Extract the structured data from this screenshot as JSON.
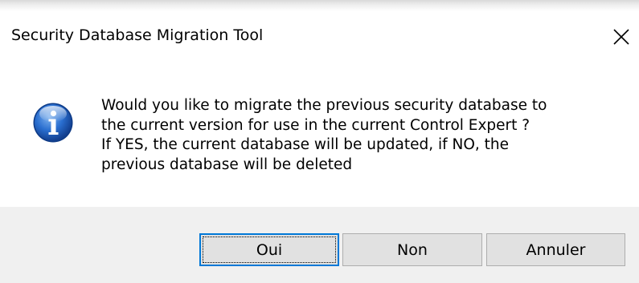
{
  "window": {
    "title": "Security Database Migration Tool",
    "close_icon": "close-icon"
  },
  "message": {
    "icon": "info-icon",
    "lines": [
      "Would you like to migrate the previous security database to",
      "the current version for use in the current Control Expert ?",
      "If YES, the current database will be updated, if NO, the",
      "previous database will be deleted"
    ]
  },
  "buttons": {
    "yes_label": "Oui",
    "no_label": "Non",
    "cancel_label": "Annuler",
    "default": "yes"
  },
  "colors": {
    "accent": "#0078d7",
    "footer_bg": "#f0f0f0",
    "button_bg": "#e1e1e1",
    "button_border": "#adadad",
    "icon_blue": "#1f5fb8"
  }
}
